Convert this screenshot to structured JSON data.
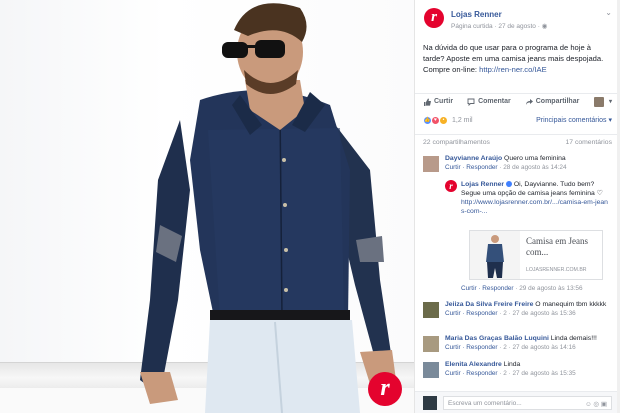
{
  "post": {
    "page_name": "Lojas Renner",
    "meta": "Página curtida · 27 de agosto · ",
    "text": "Na dúvida do que usar para o programa de hoje à tarde? Aposte em uma camisa jeans mais despojada. Compre on-line: ",
    "link": "http://ren-ner.co/IAE",
    "logo_letter": "r"
  },
  "actions": {
    "like": "Curtir",
    "comment": "Comentar",
    "share": "Compartilhar"
  },
  "reactions": {
    "count": "1,2 mil",
    "sort": "Principais comentários ▾"
  },
  "stats": {
    "shares": "22 compartilhamentos",
    "comments": "17 comentários"
  },
  "comments": [
    {
      "name": "Dayvianne Araújo",
      "text": " Quero uma feminina",
      "sub_links": "Curtir · Responder",
      "sub_time": " · 28 de agosto às 14:24"
    },
    {
      "name": "Jeiiza Da Silva Freire Freire",
      "text": " O manequim tbm kkkkk",
      "sub_links": "Curtir · Responder",
      "sub_time": " · 2 · 27 de agosto às 15:36"
    },
    {
      "name": "Maria Das Graças Balão Luquini",
      "text": " Linda demais!!!",
      "sub_links": "Curtir · Responder",
      "sub_time": " · 2 · 27 de agosto às 14:16"
    },
    {
      "name": "Elenita Alexandre",
      "text": " Linda",
      "sub_links": "Curtir · Responder",
      "sub_time": " · 2 · 27 de agosto às 15:35"
    }
  ],
  "reply": {
    "name": "Lojas Renner",
    "text": " Oi, Dayvianne. Tudo bem? Segue uma opção de camisa jeans feminina ♡",
    "link": "http://www.lojasrenner.com.br/.../camisa-em-jeans-com-...",
    "card_title": "Camisa em Jeans com...",
    "card_domain": "LOJASRENNER.COM.BR",
    "sub_links": "Curtir · Responder",
    "sub_time": " · 29 de agosto às 13:56"
  },
  "composer": {
    "placeholder": "Escreva um comentário...",
    "icons": "☺ ◎ ▣"
  },
  "colors": {
    "brand_red": "#e4032e",
    "fb_blue": "#365899"
  }
}
